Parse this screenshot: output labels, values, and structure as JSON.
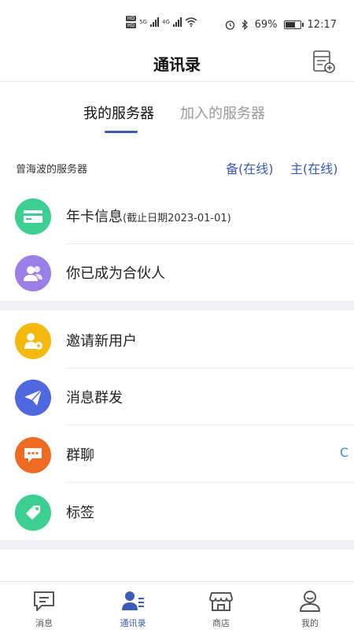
{
  "status_bar": {
    "hd_badges": [
      "HD",
      "HD"
    ],
    "net_left": "5G",
    "net_right": "4G",
    "battery": "69%",
    "battery_level": 0.69,
    "time": "12:17"
  },
  "header": {
    "title": "通讯录",
    "action_icon": "contact-list-add-icon"
  },
  "tabs": [
    {
      "label": "我的服务器",
      "active": true
    },
    {
      "label": "加入的服务器",
      "active": false
    }
  ],
  "server": {
    "name": "曾海波的服务器",
    "backup": "备(在线)",
    "main": "主(在线)"
  },
  "list_items": [
    {
      "label": "年卡信息",
      "sub": "(截止日期2023-01-01)",
      "icon": "card-icon",
      "color": "#3ccf91"
    },
    {
      "label": "你已成为合伙人",
      "icon": "partner-icon",
      "color": "#9b7fe6"
    },
    {
      "label": "邀请新用户",
      "icon": "invite-user-icon",
      "color": "#f5b80c"
    },
    {
      "label": "消息群发",
      "icon": "send-icon",
      "color": "#4f68e0"
    },
    {
      "label": "群聊",
      "icon": "group-chat-icon",
      "color": "#f06b22"
    },
    {
      "label": "标签",
      "icon": "tag-icon",
      "color": "#3ccf91"
    }
  ],
  "edge_char": "C",
  "bottom_nav": [
    {
      "label": "消息",
      "icon": "message-icon",
      "active": false
    },
    {
      "label": "通讯录",
      "icon": "contacts-icon",
      "active": true
    },
    {
      "label": "商店",
      "icon": "store-icon",
      "active": false
    },
    {
      "label": "我的",
      "icon": "profile-icon",
      "active": false
    }
  ],
  "colors": {
    "accent": "#3b5bb5",
    "divider": "#ececec",
    "section_bg": "#f2f2f6"
  }
}
